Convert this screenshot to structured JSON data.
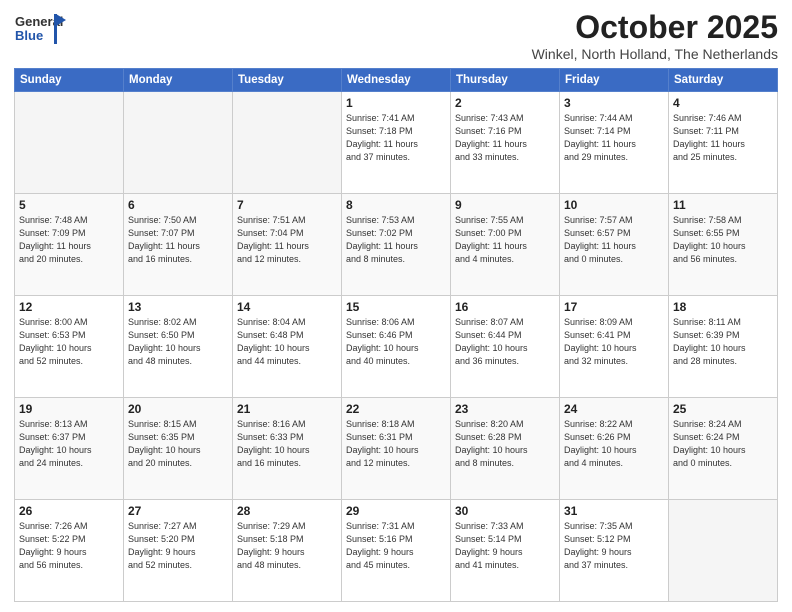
{
  "header": {
    "logo_general": "General",
    "logo_blue": "Blue",
    "month": "October 2025",
    "location": "Winkel, North Holland, The Netherlands"
  },
  "weekdays": [
    "Sunday",
    "Monday",
    "Tuesday",
    "Wednesday",
    "Thursday",
    "Friday",
    "Saturday"
  ],
  "weeks": [
    [
      {
        "day": "",
        "info": ""
      },
      {
        "day": "",
        "info": ""
      },
      {
        "day": "",
        "info": ""
      },
      {
        "day": "1",
        "info": "Sunrise: 7:41 AM\nSunset: 7:18 PM\nDaylight: 11 hours\nand 37 minutes."
      },
      {
        "day": "2",
        "info": "Sunrise: 7:43 AM\nSunset: 7:16 PM\nDaylight: 11 hours\nand 33 minutes."
      },
      {
        "day": "3",
        "info": "Sunrise: 7:44 AM\nSunset: 7:14 PM\nDaylight: 11 hours\nand 29 minutes."
      },
      {
        "day": "4",
        "info": "Sunrise: 7:46 AM\nSunset: 7:11 PM\nDaylight: 11 hours\nand 25 minutes."
      }
    ],
    [
      {
        "day": "5",
        "info": "Sunrise: 7:48 AM\nSunset: 7:09 PM\nDaylight: 11 hours\nand 20 minutes."
      },
      {
        "day": "6",
        "info": "Sunrise: 7:50 AM\nSunset: 7:07 PM\nDaylight: 11 hours\nand 16 minutes."
      },
      {
        "day": "7",
        "info": "Sunrise: 7:51 AM\nSunset: 7:04 PM\nDaylight: 11 hours\nand 12 minutes."
      },
      {
        "day": "8",
        "info": "Sunrise: 7:53 AM\nSunset: 7:02 PM\nDaylight: 11 hours\nand 8 minutes."
      },
      {
        "day": "9",
        "info": "Sunrise: 7:55 AM\nSunset: 7:00 PM\nDaylight: 11 hours\nand 4 minutes."
      },
      {
        "day": "10",
        "info": "Sunrise: 7:57 AM\nSunset: 6:57 PM\nDaylight: 11 hours\nand 0 minutes."
      },
      {
        "day": "11",
        "info": "Sunrise: 7:58 AM\nSunset: 6:55 PM\nDaylight: 10 hours\nand 56 minutes."
      }
    ],
    [
      {
        "day": "12",
        "info": "Sunrise: 8:00 AM\nSunset: 6:53 PM\nDaylight: 10 hours\nand 52 minutes."
      },
      {
        "day": "13",
        "info": "Sunrise: 8:02 AM\nSunset: 6:50 PM\nDaylight: 10 hours\nand 48 minutes."
      },
      {
        "day": "14",
        "info": "Sunrise: 8:04 AM\nSunset: 6:48 PM\nDaylight: 10 hours\nand 44 minutes."
      },
      {
        "day": "15",
        "info": "Sunrise: 8:06 AM\nSunset: 6:46 PM\nDaylight: 10 hours\nand 40 minutes."
      },
      {
        "day": "16",
        "info": "Sunrise: 8:07 AM\nSunset: 6:44 PM\nDaylight: 10 hours\nand 36 minutes."
      },
      {
        "day": "17",
        "info": "Sunrise: 8:09 AM\nSunset: 6:41 PM\nDaylight: 10 hours\nand 32 minutes."
      },
      {
        "day": "18",
        "info": "Sunrise: 8:11 AM\nSunset: 6:39 PM\nDaylight: 10 hours\nand 28 minutes."
      }
    ],
    [
      {
        "day": "19",
        "info": "Sunrise: 8:13 AM\nSunset: 6:37 PM\nDaylight: 10 hours\nand 24 minutes."
      },
      {
        "day": "20",
        "info": "Sunrise: 8:15 AM\nSunset: 6:35 PM\nDaylight: 10 hours\nand 20 minutes."
      },
      {
        "day": "21",
        "info": "Sunrise: 8:16 AM\nSunset: 6:33 PM\nDaylight: 10 hours\nand 16 minutes."
      },
      {
        "day": "22",
        "info": "Sunrise: 8:18 AM\nSunset: 6:31 PM\nDaylight: 10 hours\nand 12 minutes."
      },
      {
        "day": "23",
        "info": "Sunrise: 8:20 AM\nSunset: 6:28 PM\nDaylight: 10 hours\nand 8 minutes."
      },
      {
        "day": "24",
        "info": "Sunrise: 8:22 AM\nSunset: 6:26 PM\nDaylight: 10 hours\nand 4 minutes."
      },
      {
        "day": "25",
        "info": "Sunrise: 8:24 AM\nSunset: 6:24 PM\nDaylight: 10 hours\nand 0 minutes."
      }
    ],
    [
      {
        "day": "26",
        "info": "Sunrise: 7:26 AM\nSunset: 5:22 PM\nDaylight: 9 hours\nand 56 minutes."
      },
      {
        "day": "27",
        "info": "Sunrise: 7:27 AM\nSunset: 5:20 PM\nDaylight: 9 hours\nand 52 minutes."
      },
      {
        "day": "28",
        "info": "Sunrise: 7:29 AM\nSunset: 5:18 PM\nDaylight: 9 hours\nand 48 minutes."
      },
      {
        "day": "29",
        "info": "Sunrise: 7:31 AM\nSunset: 5:16 PM\nDaylight: 9 hours\nand 45 minutes."
      },
      {
        "day": "30",
        "info": "Sunrise: 7:33 AM\nSunset: 5:14 PM\nDaylight: 9 hours\nand 41 minutes."
      },
      {
        "day": "31",
        "info": "Sunrise: 7:35 AM\nSunset: 5:12 PM\nDaylight: 9 hours\nand 37 minutes."
      },
      {
        "day": "",
        "info": ""
      }
    ]
  ],
  "colors": {
    "header_bg": "#3a6bc4",
    "accent": "#2255aa"
  }
}
